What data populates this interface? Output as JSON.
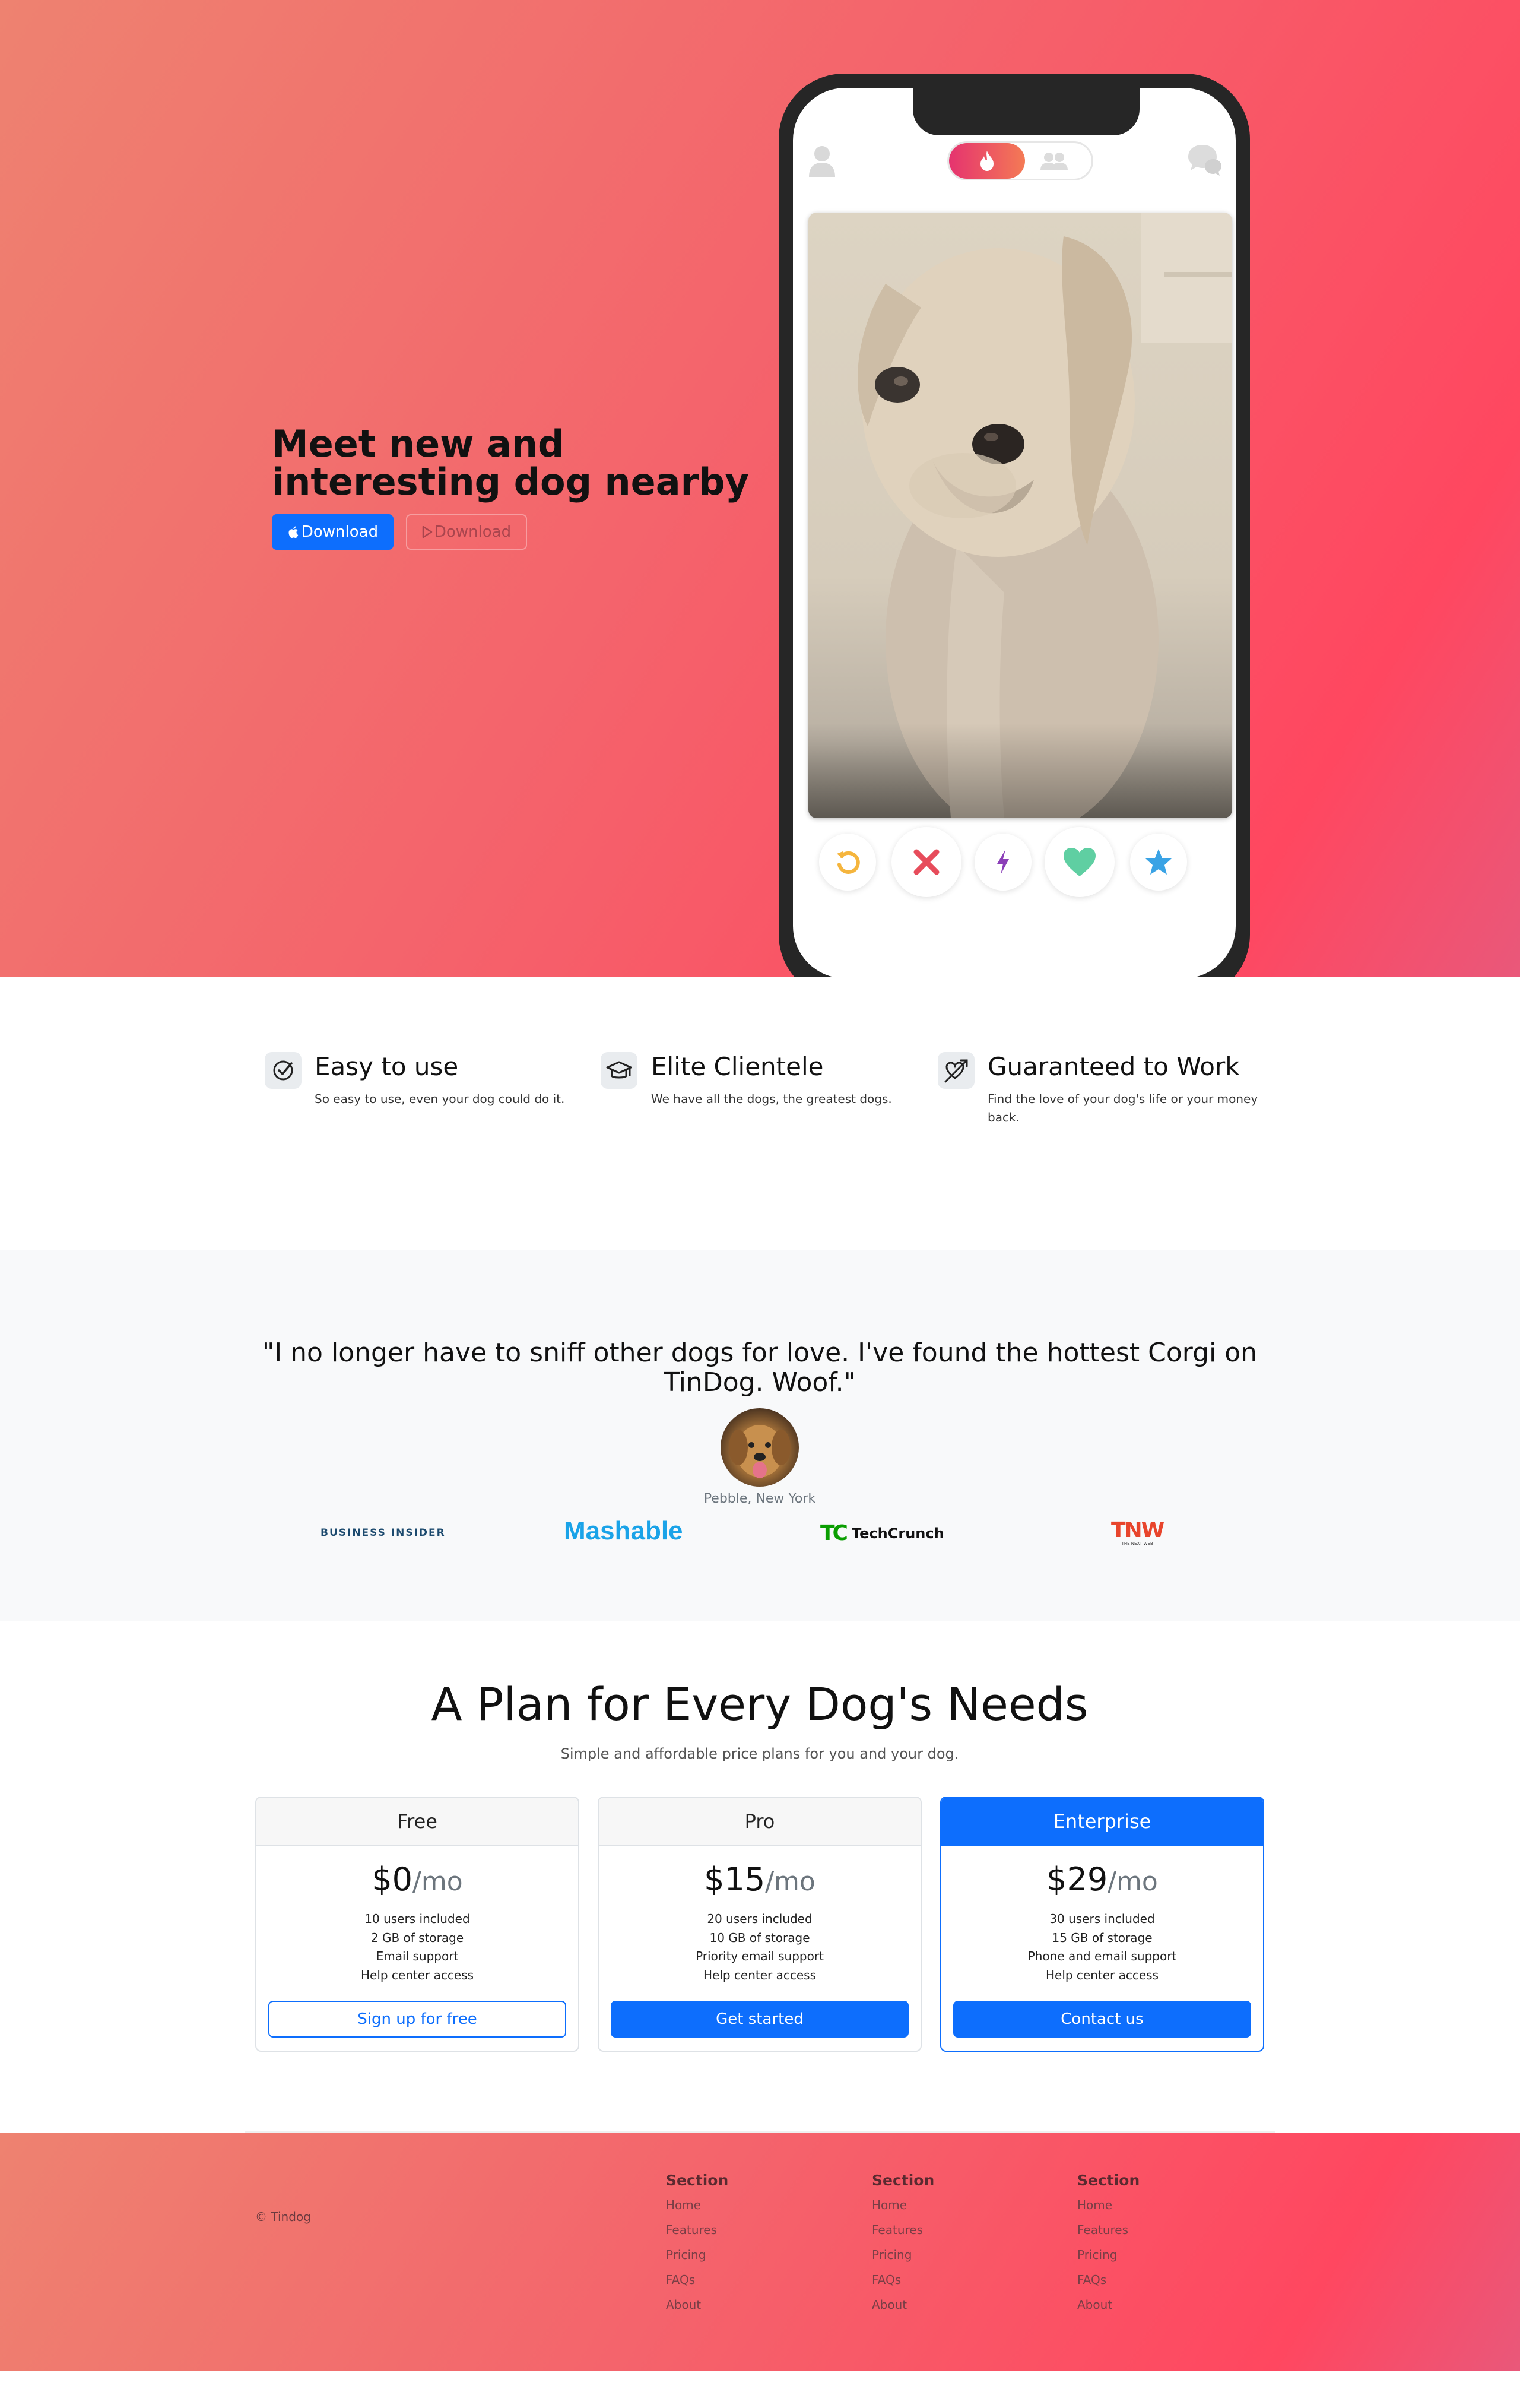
{
  "hero": {
    "title": "Meet new and interesting dog nearby",
    "ios_button": "Download",
    "android_button": "Download",
    "icons": [
      "apple-icon",
      "play-store-icon",
      "user-icon",
      "flame-icon",
      "group-icon",
      "chat-icon"
    ],
    "actions": [
      "undo-icon",
      "close-icon",
      "bolt-icon",
      "heart-icon",
      "star-icon"
    ]
  },
  "features": [
    {
      "icon": "check-circle-icon",
      "title": "Easy to use",
      "text": "So easy to use, even your dog could do it."
    },
    {
      "icon": "graduation-cap-icon",
      "title": "Elite Clientele",
      "text": "We have all the dogs, the greatest dogs."
    },
    {
      "icon": "heart-arrow-icon",
      "title": "Guaranteed to Work",
      "text": "Find the love of your dog's life or your money back."
    }
  ],
  "testimonial": {
    "quote": "\"I no longer have to sniff other dogs for love. I've found the hottest Corgi on TinDog. Woof.\"",
    "author": "Pebble, New York"
  },
  "press": {
    "business_insider": "BUSINESS INSIDER",
    "mashable": "Mashable",
    "techcrunch": "TechCrunch",
    "techcrunch_mark": "TC",
    "tnw": "TNW",
    "tnw_sub": "THE NEXT WEB"
  },
  "pricing": {
    "title": "A Plan for Every Dog's Needs",
    "subtitle": "Simple and affordable price plans for you and your dog.",
    "plans": [
      {
        "name": "Free",
        "price": "$0",
        "per": "/mo",
        "features": [
          "10 users included",
          "2 GB of storage",
          "Email support",
          "Help center access"
        ],
        "button": "Sign up for free"
      },
      {
        "name": "Pro",
        "price": "$15",
        "per": "/mo",
        "features": [
          "20 users included",
          "10 GB of storage",
          "Priority email support",
          "Help center access"
        ],
        "button": "Get started"
      },
      {
        "name": "Enterprise",
        "price": "$29",
        "per": "/mo",
        "features": [
          "30 users included",
          "15 GB of storage",
          "Phone and email support",
          "Help center access"
        ],
        "button": "Contact us"
      }
    ]
  },
  "footer": {
    "copyright": "© Tindog",
    "columns": [
      {
        "title": "Section",
        "links": [
          "Home",
          "Features",
          "Pricing",
          "FAQs",
          "About"
        ]
      },
      {
        "title": "Section",
        "links": [
          "Home",
          "Features",
          "Pricing",
          "FAQs",
          "About"
        ]
      },
      {
        "title": "Section",
        "links": [
          "Home",
          "Features",
          "Pricing",
          "FAQs",
          "About"
        ]
      }
    ]
  },
  "colors": {
    "primary": "#0d6efd",
    "gradient_start": "#ee8270",
    "gradient_end": "#ff4760"
  }
}
